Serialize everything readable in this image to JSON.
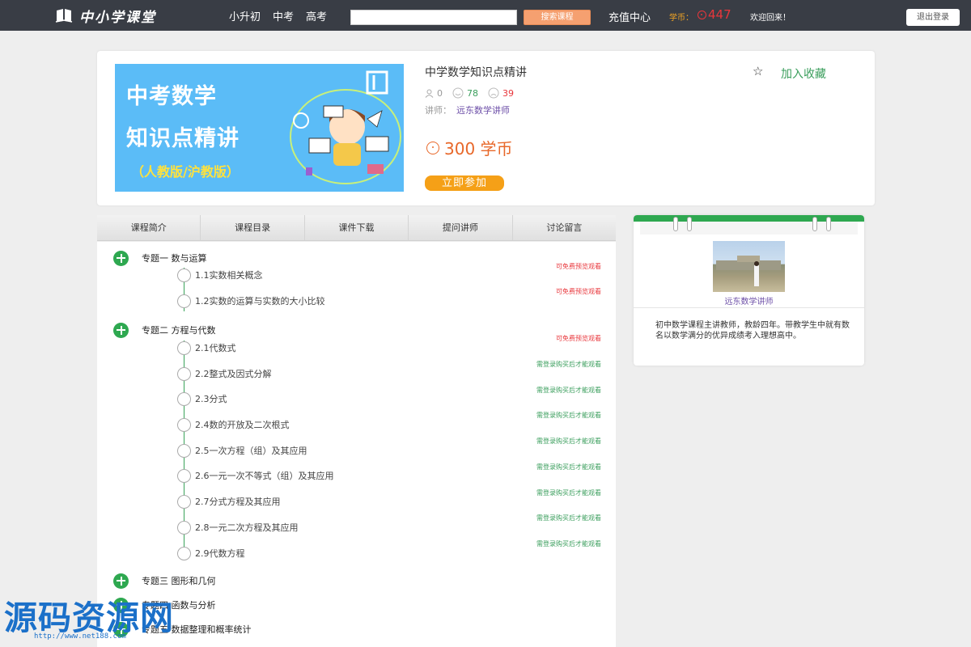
{
  "header": {
    "logo_text": "中小学课堂",
    "nav": [
      "小升初",
      "中考",
      "高考"
    ],
    "search_placeholder": "",
    "search_button": "搜索课程",
    "recharge": "充值中心",
    "coin_label": "学币：",
    "coin_value": "447",
    "welcome": "欢迎回来！",
    "logout": "退出登录"
  },
  "course": {
    "banner_line1": "中考数学",
    "banner_line2": "知识点精讲",
    "banner_line3": "（人教版/沪教版）",
    "title": "中学数学知识点精讲",
    "students": "0",
    "good": "78",
    "bad": "39",
    "teacher_label": "讲师：",
    "teacher_name": "远东数学讲师",
    "price": "300 学币",
    "join_button": "立即参加",
    "favorite": "加入收藏"
  },
  "tabs": [
    "课程简介",
    "课程目录",
    "课件下载",
    "提问讲师",
    "讨论留言"
  ],
  "chapters": [
    {
      "label": "专题一  数与运算",
      "lessons": [
        {
          "label": "1.1实数相关概念",
          "tag": "可免费预览观看",
          "free": true
        },
        {
          "label": "1.2实数的运算与实数的大小比较",
          "tag": "可免费预览观看",
          "free": true
        }
      ]
    },
    {
      "label": "专题二  方程与代数",
      "lessons": [
        {
          "label": "2.1代数式",
          "tag": "可免费预览观看",
          "free": true
        },
        {
          "label": "2.2整式及因式分解",
          "tag": "需登录购买后才能观看",
          "free": false
        },
        {
          "label": "2.3分式",
          "tag": "需登录购买后才能观看",
          "free": false
        },
        {
          "label": "2.4数的开放及二次根式",
          "tag": "需登录购买后才能观看",
          "free": false
        },
        {
          "label": "2.5一次方程（组）及其应用",
          "tag": "需登录购买后才能观看",
          "free": false
        },
        {
          "label": "2.6一元一次不等式（组）及其应用",
          "tag": "需登录购买后才能观看",
          "free": false
        },
        {
          "label": "2.7分式方程及其应用",
          "tag": "需登录购买后才能观看",
          "free": false
        },
        {
          "label": "2.8一元二次方程及其应用",
          "tag": "需登录购买后才能观看",
          "free": false
        },
        {
          "label": "2.9代数方程",
          "tag": "需登录购买后才能观看",
          "free": false
        }
      ]
    },
    {
      "label": "专题三  图形和几何",
      "lessons": []
    },
    {
      "label": "专题四  函数与分析",
      "lessons": []
    },
    {
      "label": "专题五  数据整理和概率统计",
      "lessons": []
    }
  ],
  "teacher_panel": {
    "name": "远东数学讲师",
    "description": "初中数学课程主讲教师，教龄四年。带教学生中就有数名以数学满分的优异成绩考入理想高中。"
  },
  "watermark": {
    "text": "源码资源网",
    "url": "http://www.net188.com"
  },
  "colors": {
    "topbar": "#393d45",
    "accent_green": "#2ea850",
    "accent_orange": "#f5a017",
    "price_orange": "#e8682a",
    "free_red": "#e8363b",
    "buy_green": "#3a9e5c"
  }
}
